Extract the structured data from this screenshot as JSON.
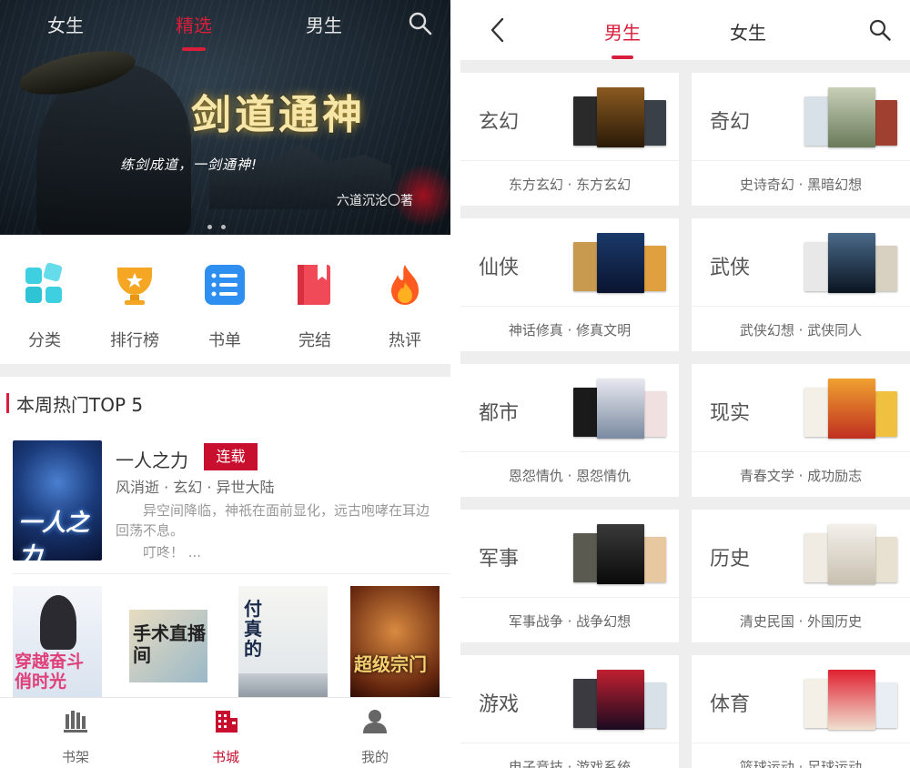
{
  "left": {
    "top_tabs": [
      "女生",
      "精选",
      "男生"
    ],
    "active_tab": "精选",
    "banner": {
      "title": "剑道通神",
      "subtitle": "练剑成道，一剑通神!",
      "author": "六道沉沦〇著"
    },
    "categories": [
      {
        "label": "分类",
        "icon": "grid-icon"
      },
      {
        "label": "排行榜",
        "icon": "trophy-icon"
      },
      {
        "label": "书单",
        "icon": "list-icon"
      },
      {
        "label": "完结",
        "icon": "bookmark-book-icon"
      },
      {
        "label": "热评",
        "icon": "flame-icon"
      }
    ],
    "hot_section_title": "本周热门TOP 5",
    "featured_book": {
      "cover_title": "一人之力",
      "name": "一人之力",
      "badge": "连载",
      "meta": "风消逝 · 玄幻 · 异世大陆",
      "desc_line1": "异空间降临，神祇在面前显化，远古咆哮在耳边回荡不息。",
      "desc_line2": "叮咚！ ..."
    },
    "covers": [
      {
        "title": "穿越奋斗俏时光"
      },
      {
        "title": "手术直播间"
      },
      {
        "title": "付真的"
      },
      {
        "title": "超级宗门"
      }
    ],
    "bottom_nav": [
      {
        "label": "书架",
        "icon": "bookshelf-icon"
      },
      {
        "label": "书城",
        "icon": "bookstore-building-icon"
      },
      {
        "label": "我的",
        "icon": "user-icon"
      }
    ],
    "active_nav": "书城",
    "colors": {
      "accent": "#d81e3a"
    }
  },
  "right": {
    "tabs": [
      "男生",
      "女生"
    ],
    "active_tab": "男生",
    "genres": [
      {
        "name": "玄幻",
        "sub": "东方玄幻 · 东方玄幻"
      },
      {
        "name": "奇幻",
        "sub": "史诗奇幻 · 黑暗幻想"
      },
      {
        "name": "仙侠",
        "sub": "神话修真 · 修真文明"
      },
      {
        "name": "武侠",
        "sub": "武侠幻想 · 武侠同人"
      },
      {
        "name": "都市",
        "sub": "恩怨情仇 · 恩怨情仇"
      },
      {
        "name": "现实",
        "sub": "青春文学 · 成功励志"
      },
      {
        "name": "军事",
        "sub": "军事战争 · 战争幻想"
      },
      {
        "name": "历史",
        "sub": "清史民国 · 外国历史"
      },
      {
        "name": "游戏",
        "sub": "电子竞技 · 游戏系统"
      },
      {
        "name": "体育",
        "sub": "篮球运动 · 足球运动"
      }
    ]
  }
}
